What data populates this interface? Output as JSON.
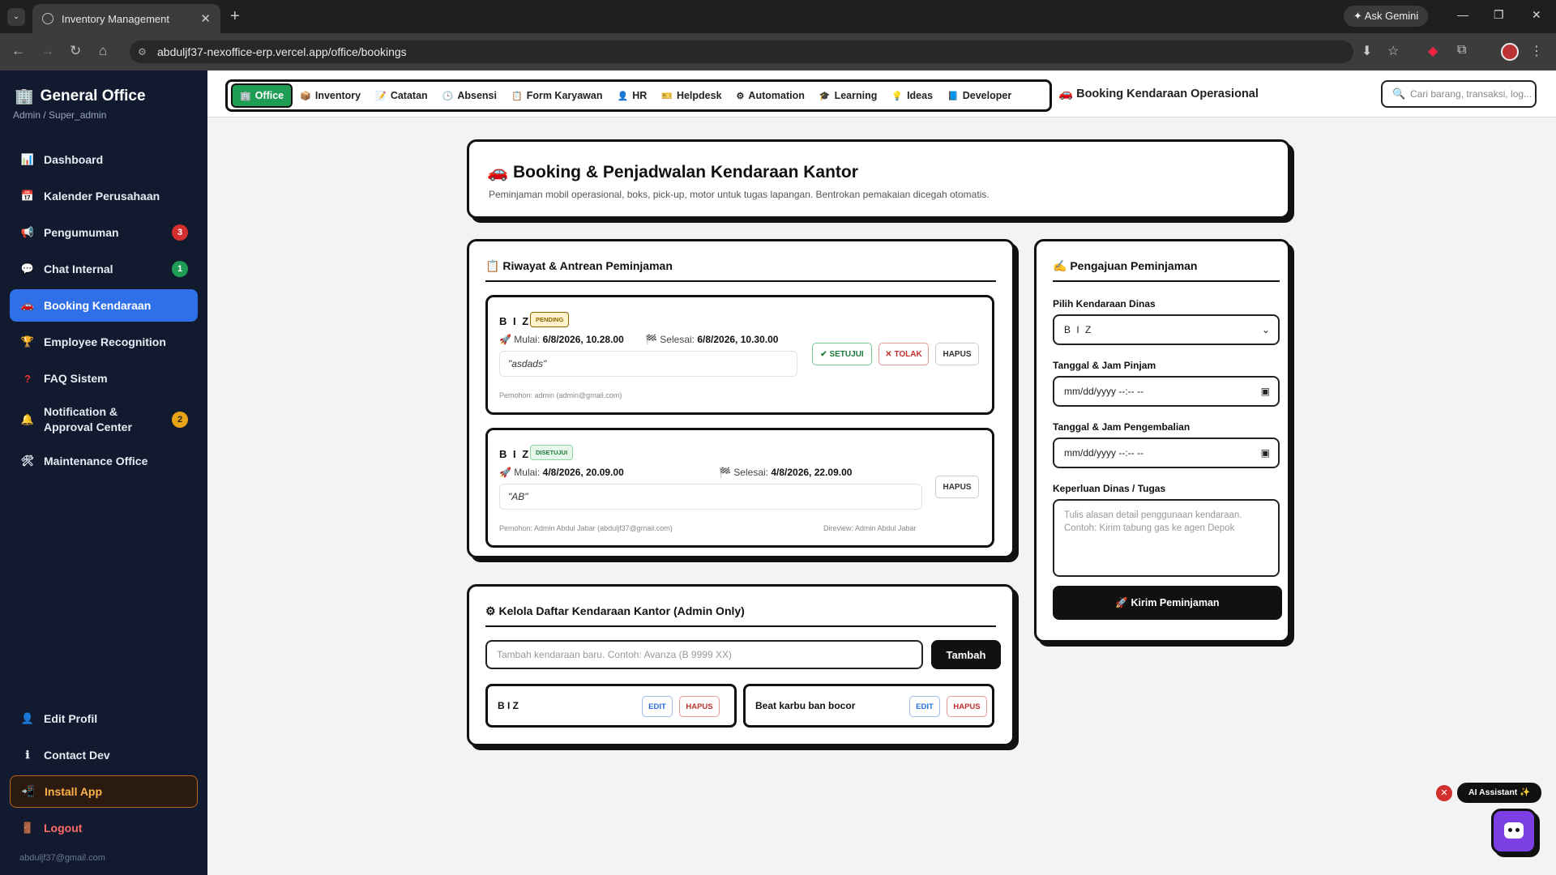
{
  "browser": {
    "tab_title": "Inventory Management",
    "url": "abduljf37-nexoffice-erp.vercel.app/office/bookings",
    "gemini_label": "Ask Gemini"
  },
  "sidebar": {
    "brand": "General Office",
    "role": "Admin / Super_admin",
    "items": [
      {
        "label": "Dashboard",
        "icon": "chart-icon"
      },
      {
        "label": "Kalender Perusahaan",
        "icon": "calendar-icon"
      },
      {
        "label": "Pengumuman",
        "icon": "megaphone-icon",
        "badge": "3"
      },
      {
        "label": "Chat Internal",
        "icon": "chat-icon",
        "badge": "1"
      },
      {
        "label": "Booking Kendaraan",
        "icon": "car-icon"
      },
      {
        "label": "Employee Recognition",
        "icon": "trophy-icon"
      },
      {
        "label": "FAQ Sistem",
        "icon": "question-icon"
      },
      {
        "label": "Notification & Approval Center",
        "icon": "bell-icon",
        "badge": "2"
      },
      {
        "label": "Maintenance Office",
        "icon": "tools-icon"
      }
    ],
    "bottom": [
      {
        "label": "Edit Profil",
        "icon": "user-icon"
      },
      {
        "label": "Contact Dev",
        "icon": "info-icon"
      },
      {
        "label": "Install App",
        "icon": "download-icon"
      },
      {
        "label": "Logout",
        "icon": "logout-icon"
      }
    ],
    "email": "abduljf37@gmail.com",
    "colors": {
      "bg": "#111a2e",
      "active": "#2f6fe8",
      "badge_red": "#d32f2f",
      "badge_green": "#1f9d55",
      "badge_orange": "#e8a317"
    }
  },
  "topnav": {
    "tabs": [
      {
        "label": "Office",
        "icon": "building-icon"
      },
      {
        "label": "Inventory",
        "icon": "box-icon"
      },
      {
        "label": "Catatan",
        "icon": "pencil-icon"
      },
      {
        "label": "Absensi",
        "icon": "clock-icon"
      },
      {
        "label": "Form Karyawan",
        "icon": "form-icon"
      },
      {
        "label": "HR",
        "icon": "person-icon"
      },
      {
        "label": "Helpdesk",
        "icon": "ticket-icon"
      },
      {
        "label": "Automation",
        "icon": "gear-icon"
      },
      {
        "label": "Learning",
        "icon": "cap-icon"
      },
      {
        "label": "Ideas",
        "icon": "bulb-icon"
      },
      {
        "label": "Developer",
        "icon": "book-icon"
      }
    ],
    "page_label": "Booking Kendaraan Operasional",
    "search_placeholder": "Cari barang, transaksi, log..."
  },
  "header": {
    "title": "Booking & Penjadwalan Kendaraan Kantor",
    "subtitle": "Peminjaman mobil operasional, boks, pick-up, motor untuk tugas lapangan. Bentrokan pemakaian dicegah otomatis."
  },
  "history": {
    "title": "Riwayat & Antrean Peminjaman",
    "bookings": [
      {
        "vehicle": "B I Z",
        "status": "PENDING",
        "start_label": "Mulai:",
        "start": "6/8/2026, 10.28.00",
        "end_label": "Selesai:",
        "end": "6/8/2026, 10.30.00",
        "note": "\"asdads\"",
        "requester": "Pemohon: admin (admin@gmail.com)",
        "actions": {
          "approve": "SETUJUI",
          "reject": "TOLAK",
          "delete": "HAPUS"
        }
      },
      {
        "vehicle": "B I Z",
        "status": "DISETUJUI",
        "start_label": "Mulai:",
        "start": "4/8/2026, 20.09.00",
        "end_label": "Selesai:",
        "end": "4/8/2026, 22.09.00",
        "note": "\"AB\"",
        "requester": "Pemohon: Admin Abdul Jabar (abduljf37@gmail.com)",
        "reviewer": "Direview: Admin Abdul Jabar",
        "actions": {
          "delete": "HAPUS"
        }
      }
    ]
  },
  "fleet": {
    "title": "Kelola Daftar Kendaraan Kantor (Admin Only)",
    "add_placeholder": "Tambah kendaraan baru. Contoh: Avanza (B 9999 XX)",
    "add_label": "Tambah",
    "vehicles": [
      {
        "name": "B I Z",
        "edit": "EDIT",
        "delete": "HAPUS"
      },
      {
        "name": "Beat karbu ban bocor",
        "edit": "EDIT",
        "delete": "HAPUS"
      }
    ]
  },
  "request_form": {
    "title": "Pengajuan Peminjaman",
    "vehicle_label": "Pilih Kendaraan Dinas",
    "vehicle_value": "B I Z",
    "start_label": "Tanggal & Jam Pinjam",
    "start_value": "mm/dd/yyyy --:-- --",
    "end_label": "Tanggal & Jam Pengembalian",
    "end_value": "mm/dd/yyyy --:-- --",
    "purpose_label": "Keperluan Dinas / Tugas",
    "purpose_placeholder": "Tulis alasan detail penggunaan kendaraan. Contoh: Kirim tabung gas ke agen Depok",
    "submit_label": "Kirim Peminjaman"
  },
  "assistant": {
    "label": "AI Assistant ✨"
  }
}
